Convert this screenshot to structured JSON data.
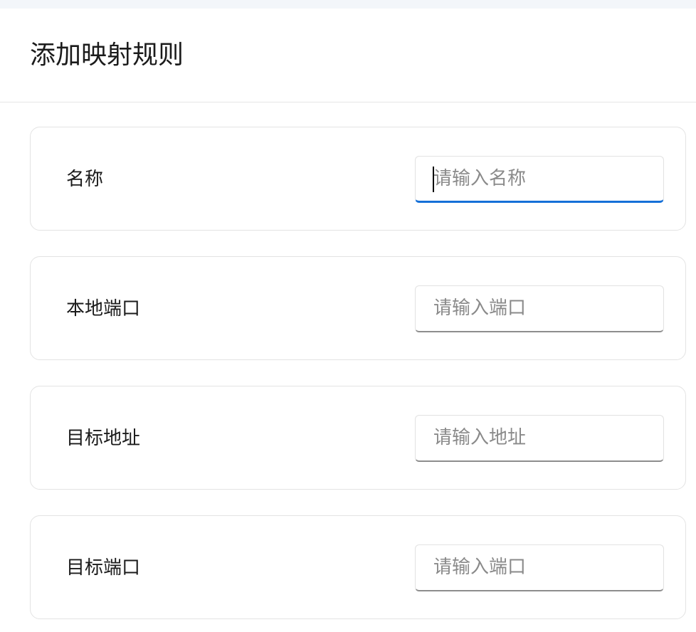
{
  "dialog": {
    "title": "添加映射规则"
  },
  "fields": [
    {
      "label": "名称",
      "placeholder": "请输入名称",
      "value": ""
    },
    {
      "label": "本地端口",
      "placeholder": "请输入端口",
      "value": ""
    },
    {
      "label": "目标地址",
      "placeholder": "请输入地址",
      "value": ""
    },
    {
      "label": "目标端口",
      "placeholder": "请输入端口",
      "value": ""
    }
  ],
  "colors": {
    "focus_accent": "#1570d8",
    "input_underline": "#8d8d8d",
    "placeholder": "#8a8a8a"
  }
}
